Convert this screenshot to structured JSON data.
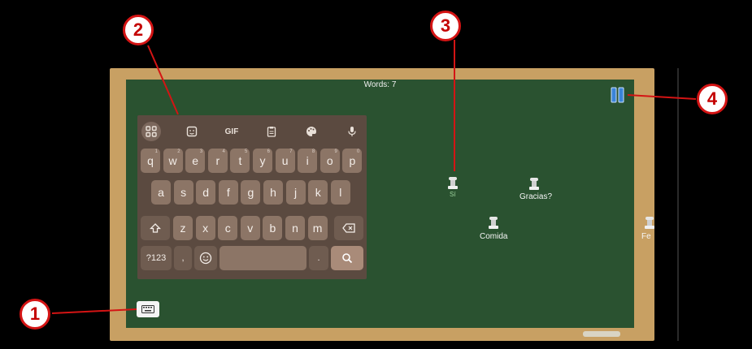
{
  "board": {
    "words_label": "Words: 7",
    "items": [
      {
        "id": "item-3",
        "label": "Sí"
      },
      {
        "id": "item-gracias",
        "label": "Gracias?"
      },
      {
        "id": "item-comida",
        "label": "Comida"
      },
      {
        "id": "item-partial",
        "label": "Fe"
      }
    ]
  },
  "keyboard": {
    "toolbar": [
      "apps-icon",
      "sticker-icon",
      "GIF",
      "clipboard-icon",
      "palette-icon",
      "mic-icon"
    ],
    "gif_label": "GIF",
    "row1": [
      "q",
      "w",
      "e",
      "r",
      "t",
      "y",
      "u",
      "i",
      "o",
      "p"
    ],
    "row1_hints": [
      "1",
      "2",
      "3",
      "4",
      "5",
      "6",
      "7",
      "8",
      "9",
      "0"
    ],
    "row2": [
      "a",
      "s",
      "d",
      "f",
      "g",
      "h",
      "j",
      "k",
      "l"
    ],
    "row3": [
      "z",
      "x",
      "c",
      "v",
      "b",
      "n",
      "m"
    ],
    "sym_label": "?123",
    "comma_label": ",",
    "period_label": "."
  },
  "callouts": [
    "1",
    "2",
    "3",
    "4"
  ],
  "colors": {
    "board": "#2a5230",
    "frame": "#c8a063",
    "keyboard": "#5b4a40",
    "callout": "#d41414"
  }
}
